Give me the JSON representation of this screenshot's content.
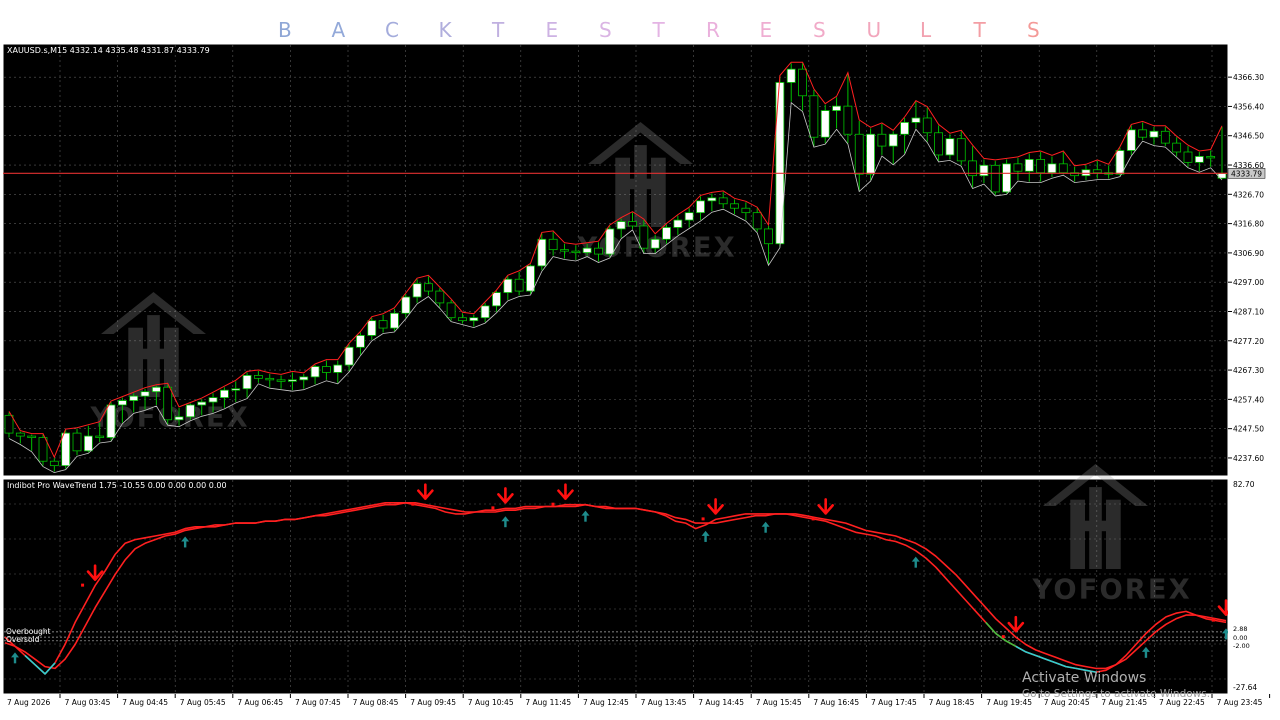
{
  "banner": {
    "letters": [
      "B",
      "A",
      "C",
      "K",
      "T",
      "E",
      "S",
      "T",
      "R",
      "E",
      "S",
      "U",
      "L",
      "T",
      "S"
    ],
    "colors": [
      "#8fa7d6",
      "#93a9d9",
      "#a4acdc",
      "#b0aedd",
      "#c0b0e0",
      "#cdb2e3",
      "#dab4e4",
      "#e4b4e4",
      "#eab0dc",
      "#efaed2",
      "#f1aac8",
      "#f2a6bc",
      "#f2a2b0",
      "#f39ea4",
      "#f49a98"
    ]
  },
  "main": {
    "symbol_label": "XAUUSD.s,M15  4332.14 4335.48 4331.87 4333.79",
    "price_ticks": [
      "4366.30",
      "4356.40",
      "4346.50",
      "4336.60",
      "4326.70",
      "4316.80",
      "4306.90",
      "4297.00",
      "4287.10",
      "4277.20",
      "4267.30",
      "4257.40",
      "4247.50",
      "4237.60"
    ],
    "current_price": "4333.79",
    "current_price_value": 4333.79,
    "price_range": [
      4231.5,
      4377.5
    ],
    "watermark": "YOFOREX"
  },
  "indicator": {
    "label": "Indibot Pro WaveTrend 1.75 -10.55 0.00 0.00 0.00 0.00",
    "axis_ticks": [
      "82.70",
      "-27.64"
    ],
    "right_level_labels": [
      "2.88",
      "0.00",
      "-2.00"
    ],
    "overbought_label": "Overbought",
    "oversold_label": "Oversold",
    "range": [
      -27.64,
      82.7
    ]
  },
  "time_axis": [
    "7 Aug 2026",
    "7 Aug 03:45",
    "7 Aug 04:45",
    "7 Aug 05:45",
    "7 Aug 06:45",
    "7 Aug 07:45",
    "7 Aug 08:45",
    "7 Aug 09:45",
    "7 Aug 10:45",
    "7 Aug 11:45",
    "7 Aug 12:45",
    "7 Aug 13:45",
    "7 Aug 14:45",
    "7 Aug 15:45",
    "7 Aug 16:45",
    "7 Aug 17:45",
    "7 Aug 18:45",
    "7 Aug 19:45",
    "7 Aug 20:45",
    "7 Aug 21:45",
    "7 Aug 22:45",
    "7 Aug 23:45"
  ],
  "activate": {
    "title": "Activate Windows",
    "subtitle": "Go to Settings to activate Windows."
  },
  "colors": {
    "background": "#000000",
    "grid": "#5a5a5a",
    "bull_fill": "#ffffff",
    "candle_border": "#00c000",
    "channel": "#ff2020",
    "price_line": "#e03030",
    "sell_arrow": "#ff1010",
    "buy_arrow": "#1e8c8c",
    "oversold_line": "#30d0d0",
    "transition_line": "#40c040"
  },
  "chart_data": {
    "type": "candlestick",
    "symbol": "XAUUSD.s",
    "timeframe": "M15",
    "ohlc": [
      [
        4252.0,
        4253.0,
        4244.5,
        4246.0
      ],
      [
        4246.0,
        4246.5,
        4242.5,
        4245.0
      ],
      [
        4245.0,
        4245.5,
        4240.0,
        4244.5
      ],
      [
        4244.5,
        4245.5,
        4235.0,
        4236.5
      ],
      [
        4236.5,
        4237.5,
        4233.0,
        4235.0
      ],
      [
        4235.0,
        4247.0,
        4234.0,
        4246.0
      ],
      [
        4246.0,
        4247.5,
        4238.5,
        4240.0
      ],
      [
        4240.0,
        4248.5,
        4239.5,
        4245.0
      ],
      [
        4245.0,
        4249.5,
        4243.0,
        4244.5
      ],
      [
        4244.5,
        4256.5,
        4243.5,
        4255.5
      ],
      [
        4255.5,
        4258.0,
        4249.5,
        4257.0
      ],
      [
        4257.0,
        4259.5,
        4253.0,
        4258.5
      ],
      [
        4258.5,
        4261.0,
        4254.0,
        4260.0
      ],
      [
        4260.0,
        4262.0,
        4255.5,
        4261.5
      ],
      [
        4261.5,
        4262.5,
        4249.0,
        4250.5
      ],
      [
        4250.5,
        4254.5,
        4248.5,
        4251.5
      ],
      [
        4251.5,
        4256.0,
        4250.5,
        4255.5
      ],
      [
        4255.5,
        4257.5,
        4252.0,
        4256.5
      ],
      [
        4256.5,
        4259.5,
        4253.0,
        4258.0
      ],
      [
        4258.0,
        4261.5,
        4254.5,
        4260.5
      ],
      [
        4260.5,
        4263.5,
        4256.5,
        4261.0
      ],
      [
        4261.0,
        4266.5,
        4258.0,
        4265.5
      ],
      [
        4265.5,
        4267.0,
        4263.0,
        4264.5
      ],
      [
        4264.5,
        4266.0,
        4261.5,
        4264.0
      ],
      [
        4264.0,
        4265.5,
        4261.0,
        4263.5
      ],
      [
        4263.5,
        4266.5,
        4260.5,
        4264.0
      ],
      [
        4264.0,
        4266.0,
        4261.0,
        4265.0
      ],
      [
        4265.0,
        4269.0,
        4262.5,
        4268.5
      ],
      [
        4268.5,
        4270.5,
        4264.0,
        4266.5
      ],
      [
        4266.5,
        4270.5,
        4263.0,
        4269.0
      ],
      [
        4269.0,
        4276.0,
        4267.0,
        4275.0
      ],
      [
        4275.0,
        4280.0,
        4272.5,
        4279.0
      ],
      [
        4279.0,
        4285.0,
        4277.5,
        4284.0
      ],
      [
        4284.0,
        4286.0,
        4280.0,
        4281.5
      ],
      [
        4281.5,
        4288.0,
        4280.5,
        4286.5
      ],
      [
        4286.5,
        4293.0,
        4285.0,
        4292.0
      ],
      [
        4292.0,
        4298.0,
        4290.0,
        4296.5
      ],
      [
        4296.5,
        4299.0,
        4292.5,
        4294.0
      ],
      [
        4294.0,
        4295.0,
        4288.5,
        4290.0
      ],
      [
        4290.0,
        4291.0,
        4284.0,
        4285.0
      ],
      [
        4285.0,
        4286.5,
        4283.0,
        4284.0
      ],
      [
        4284.0,
        4286.0,
        4282.0,
        4285.0
      ],
      [
        4285.0,
        4290.0,
        4283.5,
        4289.0
      ],
      [
        4289.0,
        4294.0,
        4287.0,
        4293.5
      ],
      [
        4293.5,
        4299.0,
        4291.0,
        4298.0
      ],
      [
        4298.0,
        4300.5,
        4292.5,
        4294.0
      ],
      [
        4294.0,
        4303.0,
        4293.0,
        4302.5
      ],
      [
        4302.5,
        4313.5,
        4301.0,
        4311.5
      ],
      [
        4311.5,
        4314.0,
        4306.0,
        4308.0
      ],
      [
        4308.0,
        4310.0,
        4305.0,
        4307.5
      ],
      [
        4307.5,
        4309.5,
        4304.5,
        4307.0
      ],
      [
        4307.0,
        4310.0,
        4306.0,
        4308.5
      ],
      [
        4308.5,
        4310.5,
        4304.0,
        4306.5
      ],
      [
        4306.5,
        4316.0,
        4305.5,
        4315.0
      ],
      [
        4315.0,
        4318.5,
        4312.0,
        4317.5
      ],
      [
        4317.5,
        4320.5,
        4315.0,
        4316.0
      ],
      [
        4316.0,
        4318.0,
        4307.0,
        4308.5
      ],
      [
        4308.5,
        4313.0,
        4307.0,
        4311.5
      ],
      [
        4311.5,
        4316.5,
        4310.0,
        4315.5
      ],
      [
        4315.5,
        4319.5,
        4313.0,
        4318.0
      ],
      [
        4318.0,
        4322.0,
        4315.5,
        4320.5
      ],
      [
        4320.5,
        4326.0,
        4318.0,
        4324.5
      ],
      [
        4324.5,
        4327.0,
        4321.0,
        4325.5
      ],
      [
        4325.5,
        4327.5,
        4322.0,
        4323.5
      ],
      [
        4323.5,
        4325.0,
        4320.0,
        4322.0
      ],
      [
        4322.0,
        4324.0,
        4318.0,
        4320.5
      ],
      [
        4320.5,
        4322.0,
        4314.0,
        4315.0
      ],
      [
        4315.0,
        4316.0,
        4303.0,
        4310.0
      ],
      [
        4310.0,
        4366.5,
        4309.0,
        4364.5
      ],
      [
        4364.5,
        4371.0,
        4358.0,
        4369.0
      ],
      [
        4369.0,
        4371.0,
        4355.0,
        4360.0
      ],
      [
        4360.0,
        4362.0,
        4343.0,
        4346.0
      ],
      [
        4346.0,
        4357.0,
        4344.0,
        4355.0
      ],
      [
        4355.0,
        4359.5,
        4349.0,
        4356.5
      ],
      [
        4356.5,
        4367.5,
        4344.0,
        4347.0
      ],
      [
        4347.0,
        4351.5,
        4328.0,
        4333.5
      ],
      [
        4333.5,
        4349.0,
        4331.5,
        4347.0
      ],
      [
        4347.0,
        4350.5,
        4340.0,
        4343.0
      ],
      [
        4343.0,
        4348.0,
        4337.0,
        4347.0
      ],
      [
        4347.0,
        4352.5,
        4340.5,
        4351.0
      ],
      [
        4351.0,
        4358.0,
        4349.0,
        4352.5
      ],
      [
        4352.5,
        4356.0,
        4344.5,
        4347.5
      ],
      [
        4347.5,
        4350.0,
        4338.0,
        4340.0
      ],
      [
        4340.0,
        4347.0,
        4338.5,
        4345.5
      ],
      [
        4345.5,
        4348.0,
        4336.5,
        4338.0
      ],
      [
        4338.0,
        4343.0,
        4329.0,
        4333.0
      ],
      [
        4333.0,
        4338.5,
        4330.5,
        4336.5
      ],
      [
        4336.5,
        4338.0,
        4326.5,
        4327.5
      ],
      [
        4327.5,
        4338.5,
        4327.0,
        4337.0
      ],
      [
        4337.0,
        4339.0,
        4331.5,
        4334.5
      ],
      [
        4334.5,
        4340.5,
        4331.0,
        4338.5
      ],
      [
        4338.5,
        4341.0,
        4331.0,
        4334.0
      ],
      [
        4334.0,
        4339.5,
        4332.5,
        4337.0
      ],
      [
        4337.0,
        4341.0,
        4333.5,
        4334.0
      ],
      [
        4334.0,
        4336.0,
        4331.0,
        4333.0
      ],
      [
        4333.0,
        4336.5,
        4331.5,
        4335.0
      ],
      [
        4335.0,
        4338.0,
        4332.0,
        4334.0
      ],
      [
        4334.0,
        4336.5,
        4332.0,
        4333.5
      ],
      [
        4333.5,
        4342.5,
        4333.0,
        4341.5
      ],
      [
        4341.5,
        4350.0,
        4340.0,
        4348.5
      ],
      [
        4348.5,
        4351.0,
        4345.0,
        4346.0
      ],
      [
        4346.0,
        4349.5,
        4343.5,
        4348.0
      ],
      [
        4348.0,
        4349.5,
        4343.0,
        4344.0
      ],
      [
        4344.0,
        4346.0,
        4339.5,
        4341.0
      ],
      [
        4341.0,
        4343.0,
        4336.0,
        4337.5
      ],
      [
        4337.5,
        4341.0,
        4334.5,
        4339.5
      ],
      [
        4339.5,
        4341.5,
        4336.0,
        4339.0
      ],
      [
        4332.14,
        4349.5,
        4331.87,
        4333.79
      ]
    ],
    "wavetrend_wt1": [
      0,
      -5,
      -10,
      -15,
      -20,
      -14,
      -4,
      8,
      18,
      28,
      36,
      45,
      51,
      53,
      54,
      55,
      56,
      57,
      59,
      60,
      60,
      60,
      61,
      62,
      62,
      62,
      63,
      63,
      64,
      64,
      65,
      66,
      67,
      68,
      69,
      70,
      71,
      72,
      73,
      73,
      73,
      72,
      71,
      70,
      68,
      67,
      67,
      68,
      69,
      69,
      70,
      70,
      71,
      71,
      71,
      71,
      72,
      72,
      72,
      71,
      70,
      70,
      70,
      70,
      69,
      68,
      66,
      63,
      62,
      59,
      61,
      64,
      65,
      66,
      67,
      67,
      67,
      67,
      67,
      66,
      65,
      64,
      63,
      61,
      59,
      57,
      56,
      55,
      53,
      52,
      50,
      47,
      43,
      38,
      32,
      26,
      20,
      14,
      8,
      2,
      -2,
      -5,
      -8,
      -10,
      -12,
      -14,
      -16,
      -17,
      -18,
      -19,
      -18,
      -15,
      -10,
      -4,
      2,
      7,
      11,
      13,
      14,
      12,
      10,
      9,
      8
    ],
    "wavetrend_wt2": [
      -3,
      -5,
      -8,
      -12,
      -16,
      -17,
      -12,
      -4,
      6,
      16,
      25,
      34,
      42,
      48,
      51,
      53,
      55,
      56,
      58,
      59,
      60,
      61,
      61,
      62,
      62,
      62,
      63,
      63,
      64,
      64,
      65,
      66,
      66,
      67,
      68,
      69,
      70,
      71,
      72,
      72,
      73,
      73,
      72,
      71,
      70,
      69,
      68,
      68,
      68,
      68,
      69,
      69,
      70,
      70,
      71,
      71,
      71,
      71,
      72,
      71,
      71,
      70,
      70,
      70,
      69,
      68,
      67,
      65,
      64,
      62,
      62,
      62,
      63,
      64,
      65,
      66,
      66,
      67,
      67,
      67,
      66,
      65,
      64,
      63,
      62,
      60,
      58,
      57,
      56,
      55,
      53,
      51,
      48,
      44,
      39,
      34,
      28,
      22,
      16,
      10,
      5,
      0,
      -4,
      -7,
      -9,
      -11,
      -13,
      -15,
      -16,
      -17,
      -17,
      -15,
      -12,
      -7,
      -2,
      3,
      7,
      10,
      12,
      12,
      11,
      10,
      9
    ],
    "signals": {
      "sell_indices": [
        8,
        37,
        44,
        49,
        62,
        72,
        89,
        112
      ],
      "buy_indices": [
        1,
        16,
        44,
        51,
        61,
        67,
        80,
        100,
        112
      ]
    },
    "price_line": 4333.79,
    "overbought_level": 2.88,
    "oversold_level": -2.0
  }
}
